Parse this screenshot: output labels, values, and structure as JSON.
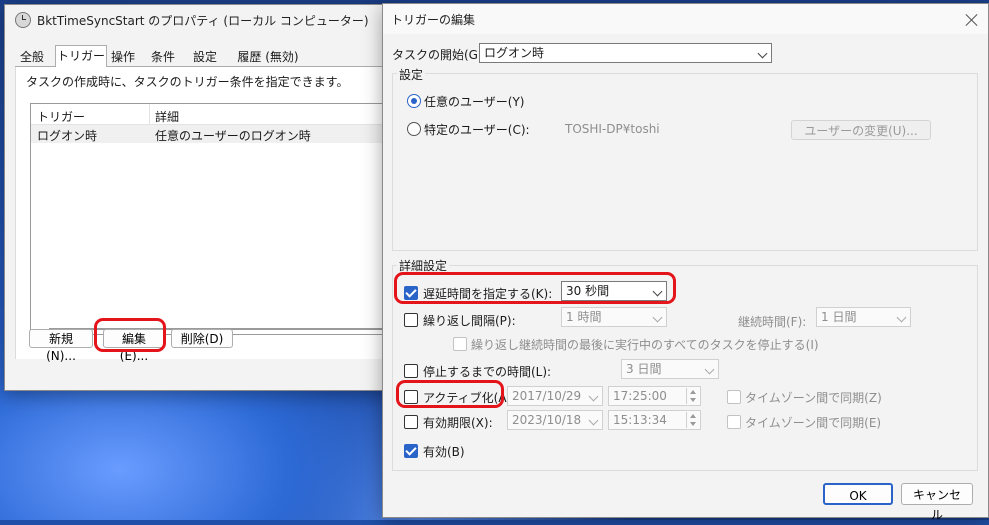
{
  "back_window": {
    "title": "BktTimeSyncStart のプロパティ (ローカル コンピューター)",
    "tabs": [
      "全般",
      "トリガー",
      "操作",
      "条件",
      "設定",
      "履歴 (無効)"
    ],
    "description": "タスクの作成時に、タスクのトリガー条件を指定できます。",
    "table": {
      "headers": [
        "トリガー",
        "詳細"
      ],
      "rows": [
        [
          "ログオン時",
          "任意のユーザーのログオン時"
        ]
      ]
    },
    "buttons": {
      "new": "新規(N)...",
      "edit": "編集(E)...",
      "delete": "削除(D)"
    }
  },
  "dialog": {
    "title": "トリガーの編集",
    "task_start_label": "タスクの開始(G):",
    "task_start_value": "ログオン時",
    "settings_group": "設定",
    "any_user_label": "任意のユーザー(Y)",
    "specific_user_label": "特定のユーザー(C):",
    "specific_user_value": "TOSHI-DP¥toshi",
    "change_user_button": "ユーザーの変更(U)...",
    "advanced_group": "詳細設定",
    "delay_label": "遅延時間を指定する(K):",
    "delay_value": "30 秒間",
    "repeat_label": "繰り返し間隔(P):",
    "repeat_value": "1 時間",
    "duration_label": "継続時間(F):",
    "duration_value": "1 日間",
    "stop_all_label": "繰り返し継続時間の最後に実行中のすべてのタスクを停止する(I)",
    "stop_after_label": "停止するまでの時間(L):",
    "stop_after_value": "3 日間",
    "activate_label": "アクティブ化(A):",
    "activate_date": "2017/10/29",
    "activate_time": "17:25:00",
    "tz_sync_label_1": "タイムゾーン間で同期(Z)",
    "expire_label": "有効期限(X):",
    "expire_date": "2023/10/18",
    "expire_time": "15:13:34",
    "tz_sync_label_2": "タイムゾーン間で同期(E)",
    "enabled_label": "有効(B)",
    "ok_button": "OK",
    "cancel_button": "キャンセル"
  },
  "colors": {
    "annotation": "#e4141b",
    "accent": "#2b64c8"
  }
}
